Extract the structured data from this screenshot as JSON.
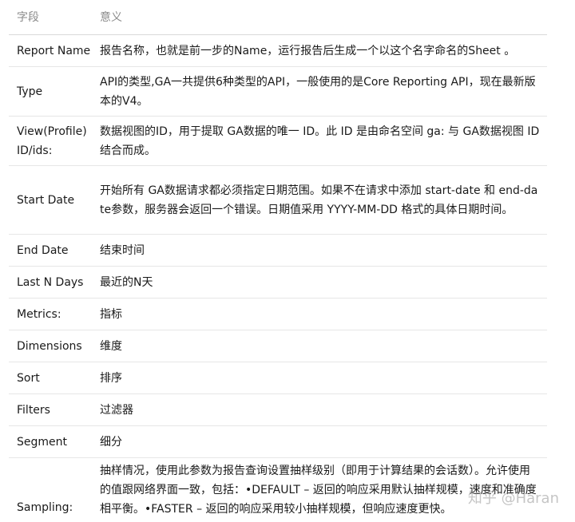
{
  "table": {
    "headers": {
      "field": "字段",
      "meaning": "意义"
    },
    "rows": [
      {
        "field": "Report Name",
        "meaning": "报告名称，也就是前一步的Name，运行报告后生成一个以这个名字命名的Sheet 。"
      },
      {
        "field": "Type",
        "meaning": "API的类型,GA一共提供6种类型的API，一般使用的是Core Reporting API，现在最新版本的V4。"
      },
      {
        "field": "View(Profile) ID/ids:",
        "meaning": "数据视图的ID，用于提取 GA数据的唯一 ID。此 ID 是由命名空间 ga: 与 GA数据视图 ID 结合而成。"
      },
      {
        "field": "Start Date",
        "meaning": "开始所有 GA数据请求都必须指定日期范围。如果不在请求中添加 start-date 和 end-date参数，服务器会返回一个错误。日期值采用 YYYY-MM-DD 格式的具体日期时间。"
      },
      {
        "field": "End Date",
        "meaning": "结束时间"
      },
      {
        "field": "Last N Days",
        "meaning": "最近的N天"
      },
      {
        "field": "Metrics:",
        "meaning": "指标"
      },
      {
        "field": "Dimensions",
        "meaning": "维度"
      },
      {
        "field": "Sort",
        "meaning": "排序"
      },
      {
        "field": "Filters",
        "meaning": "过滤器"
      },
      {
        "field": "Segment",
        "meaning": "细分"
      },
      {
        "field": "Sampling:",
        "meaning": "抽样情况，使用此参数为报告查询设置抽样级别（即用于计算结果的会话数）。允许使用的值跟网络界面一致，包括：•DEFAULT – 返回的响应采用默认抽样规模，速度和准确度相平衡。•FASTER – 返回的响应采用较小抽样规模，但响应速度更快。"
      }
    ]
  },
  "watermark": "知乎 @Haran"
}
